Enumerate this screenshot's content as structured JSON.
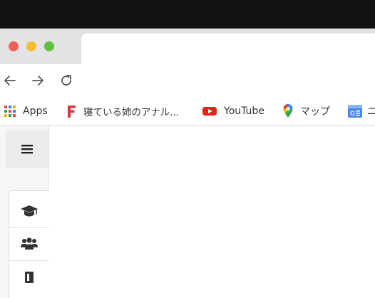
{
  "window": {
    "controls": {
      "close_color": "#ee5f57",
      "minimize_color": "#f4bd2f",
      "maximize_color": "#5ec23e"
    }
  },
  "toolbar": {
    "back_icon": "arrow-left-icon",
    "forward_icon": "arrow-right-icon",
    "reload_icon": "reload-icon"
  },
  "bookmarks": [
    {
      "label": "Apps",
      "icon": "apps-grid-icon"
    },
    {
      "label": "寝ている姉のアナル...",
      "icon": "f-logo-icon"
    },
    {
      "label": "YouTube",
      "icon": "youtube-icon"
    },
    {
      "label": "マップ",
      "icon": "maps-pin-icon"
    },
    {
      "label": "ニ",
      "icon": "google-news-icon"
    }
  ],
  "sidebar": {
    "menu_icon": "hamburger-icon",
    "items": [
      {
        "icon": "graduation-cap-icon"
      },
      {
        "icon": "users-icon"
      },
      {
        "icon": "book-icon"
      }
    ]
  },
  "colors": {
    "brand_f": "#d8333f",
    "youtube_red": "#e62117",
    "sidebar_icon": "#333333"
  }
}
